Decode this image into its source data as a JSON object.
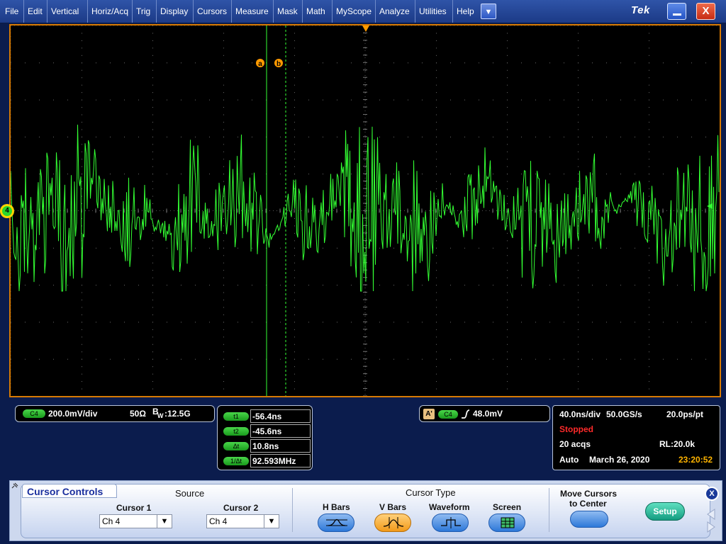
{
  "menu": {
    "items": [
      "File",
      "Edit",
      "Vertical",
      "Horiz/Acq",
      "Trig",
      "Display",
      "Cursors",
      "Measure",
      "Mask",
      "Math",
      "MyScope",
      "Analyze",
      "Utilities",
      "Help"
    ],
    "dropdown_glyph": "▼",
    "brand": "Tek",
    "close_glyph": "X"
  },
  "screen": {
    "cursor_a_label": "a",
    "cursor_b_label": "b",
    "channel_marker": "4"
  },
  "channel": {
    "badge": "C4",
    "scale": "200.0mV/div",
    "impedance": "50Ω",
    "bw_prefix": "B",
    "bw_sub": "W",
    "bw_value": ":12.5G"
  },
  "cursor_readout": {
    "t1_label": "t1",
    "t1_value": "-56.4ns",
    "t2_label": "t2",
    "t2_value": "-45.6ns",
    "dt_label": "Δt",
    "dt_value": "10.8ns",
    "inv_label": "1/Δt",
    "inv_value": "92.593MHz"
  },
  "trigger": {
    "mode_label": "A'",
    "source": "C4",
    "level": "48.0mV"
  },
  "timebase": {
    "horiz": "40.0ns/div",
    "rate": "50.0GS/s",
    "resolution": "20.0ps/pt",
    "state": "Stopped",
    "acqs": "20 acqs",
    "record": "RL:20.0k",
    "mode": "Auto",
    "date": "March 26, 2020",
    "time": "23:20:52"
  },
  "cursor_controls": {
    "title": "Cursor Controls",
    "source_label": "Source",
    "cursor1_label": "Cursor 1",
    "cursor1_value": "Ch 4",
    "cursor2_label": "Cursor 2",
    "cursor2_value": "Ch 4",
    "type_label": "Cursor Type",
    "types": [
      "H Bars",
      "V Bars",
      "Waveform",
      "Screen"
    ],
    "selected_type": "V Bars",
    "move_label_1": "Move Cursors",
    "move_label_2": "to Center",
    "setup_label": "Setup",
    "close_glyph": "X"
  },
  "colors": {
    "waveform": "#33ff33",
    "cursor_a": "#33ff33",
    "graticule_border": "#d87a00",
    "stopped": "#ff2a2a",
    "time": "#ffb400"
  }
}
